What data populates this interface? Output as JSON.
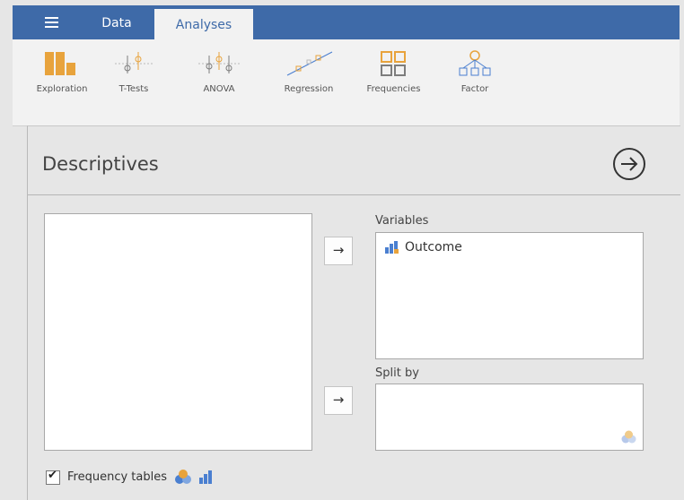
{
  "tabs": {
    "data": "Data",
    "analyses": "Analyses"
  },
  "ribbon": {
    "exploration": "Exploration",
    "ttests": "T-Tests",
    "anova": "ANOVA",
    "regression": "Regression",
    "frequencies": "Frequencies",
    "factor": "Factor"
  },
  "analysis": {
    "title": "Descriptives",
    "variables_label": "Variables",
    "variables": [
      "Outcome"
    ],
    "split_by_label": "Split by",
    "frequency_tables_label": "Frequency tables",
    "frequency_tables_checked": true,
    "move_arrow": "→"
  },
  "colors": {
    "topbar": "#3e6aa8",
    "exploration_icon": "#e8a33c",
    "variable_icon": "#4a7fd0"
  }
}
